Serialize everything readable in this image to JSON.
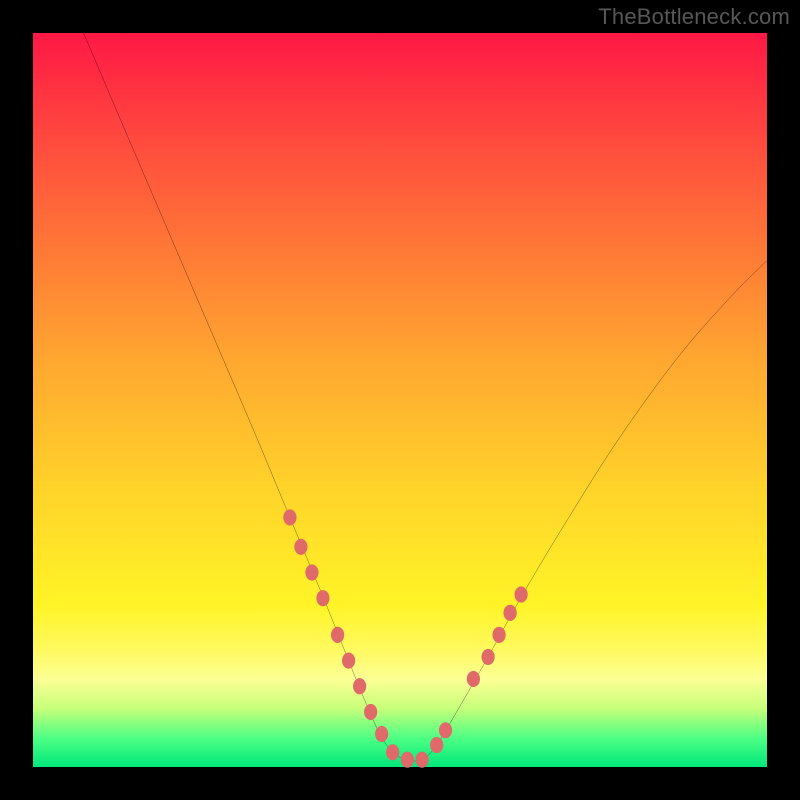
{
  "watermark": "TheBottleneck.com",
  "chart_data": {
    "type": "line",
    "title": "",
    "xlabel": "",
    "ylabel": "",
    "xlim": [
      0,
      100
    ],
    "ylim": [
      0,
      100
    ],
    "curve": {
      "name": "bottleneck-curve",
      "x": [
        0,
        6,
        12,
        18,
        24,
        30,
        35,
        40,
        44,
        47,
        49,
        51,
        53,
        55,
        58,
        62,
        67,
        73,
        80,
        88,
        95,
        100
      ],
      "y": [
        115,
        102,
        88,
        74,
        60,
        46,
        34,
        22,
        12,
        5,
        2,
        1,
        1,
        3,
        8,
        15,
        24,
        34,
        45,
        56,
        64,
        69
      ]
    },
    "markers": {
      "name": "highlight-points",
      "color": "#e06a6a",
      "x": [
        35.0,
        36.5,
        38.0,
        39.5,
        41.5,
        43.0,
        44.5,
        46.0,
        47.5,
        49.0,
        51.0,
        53.0,
        55.0,
        56.2,
        60.0,
        62.0,
        63.5,
        65.0,
        66.5
      ],
      "y": [
        34.0,
        30.0,
        26.5,
        23.0,
        18.0,
        14.5,
        11.0,
        7.5,
        4.5,
        2.0,
        1.0,
        1.0,
        3.0,
        5.0,
        12.0,
        15.0,
        18.0,
        21.0,
        23.5
      ]
    },
    "gradient_stops": [
      {
        "offset": 0.0,
        "color": "#ff1845"
      },
      {
        "offset": 0.15,
        "color": "#ff4b3e"
      },
      {
        "offset": 0.3,
        "color": "#ff7a36"
      },
      {
        "offset": 0.45,
        "color": "#ffa830"
      },
      {
        "offset": 0.62,
        "color": "#ffd32a"
      },
      {
        "offset": 0.78,
        "color": "#fff427"
      },
      {
        "offset": 0.84,
        "color": "#fffa60"
      },
      {
        "offset": 0.88,
        "color": "#fcff94"
      },
      {
        "offset": 0.92,
        "color": "#c7ff7a"
      },
      {
        "offset": 0.96,
        "color": "#4fff84"
      },
      {
        "offset": 1.0,
        "color": "#00e87a"
      }
    ]
  }
}
